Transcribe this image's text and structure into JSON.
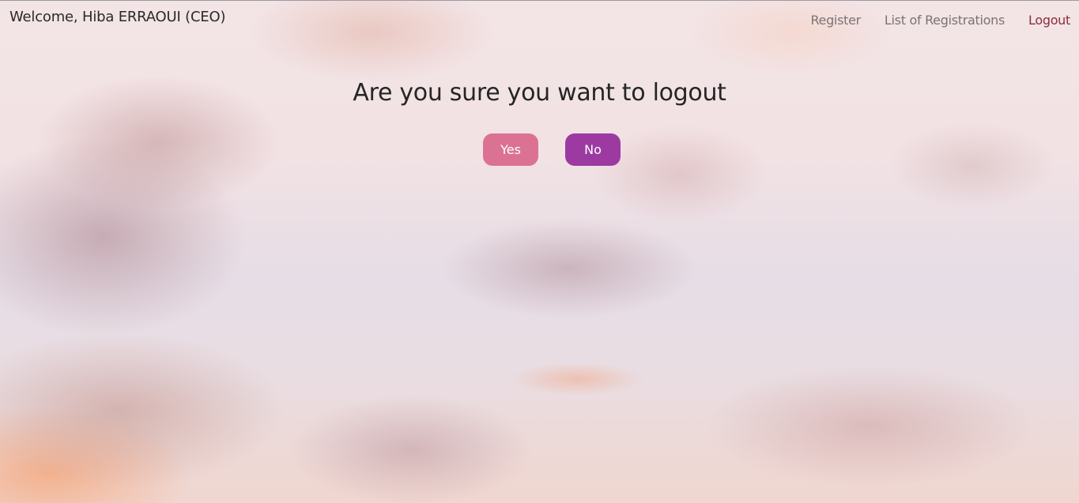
{
  "navbar": {
    "brand": "Welcome, Hiba ERRAOUI (CEO)",
    "links": [
      {
        "label": "Register"
      },
      {
        "label": "List of Registrations"
      },
      {
        "label": "Logout"
      }
    ]
  },
  "main": {
    "heading": "Are you sure you want to logout",
    "yes_label": "Yes",
    "no_label": "No"
  },
  "colors": {
    "yes_button": "#db7293",
    "no_button": "#9c3aa2",
    "active_link": "#8a2f3a"
  }
}
